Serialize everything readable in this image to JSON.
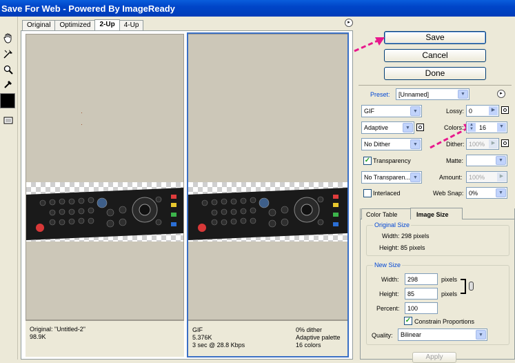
{
  "window": {
    "title": "Save For Web - Powered By ImageReady"
  },
  "tabs": [
    {
      "label": "Original",
      "active": false
    },
    {
      "label": "Optimized",
      "active": false
    },
    {
      "label": "2-Up",
      "active": true
    },
    {
      "label": "4-Up",
      "active": false
    }
  ],
  "tools": [
    "hand-icon",
    "slice-select-icon",
    "zoom-icon",
    "eyedropper-icon",
    "eyedropper-color-swatch",
    "toggle-slices-icon"
  ],
  "left_pane": {
    "line1": "Original: \"Untitled-2\"",
    "line2": "98.9K"
  },
  "right_pane": {
    "left_lines": [
      "GIF",
      "5.376K",
      "3 sec @ 28.8 Kbps"
    ],
    "right_lines": [
      "0% dither",
      "Adaptive palette",
      "16 colors"
    ]
  },
  "buttons": {
    "save": "Save",
    "cancel": "Cancel",
    "done": "Done"
  },
  "settings": {
    "preset_label": "Preset:",
    "preset_value": "[Unnamed]",
    "format": "GIF",
    "lossy_label": "Lossy:",
    "lossy_value": "0",
    "reduction": "Adaptive",
    "colors_label": "Colors:",
    "colors_value": "16",
    "dither_algo": "No Dither",
    "dither_label": "Dither:",
    "dither_value": "100%",
    "transparency_label": "Transparency",
    "transparency_checked": true,
    "matte_label": "Matte:",
    "matte_value": "",
    "transparency_dither": "No Transparen...",
    "amount_label": "Amount:",
    "amount_value": "100%",
    "interlaced_label": "Interlaced",
    "interlaced_checked": false,
    "websnap_label": "Web Snap:",
    "websnap_value": "0%"
  },
  "panel_tabs": [
    {
      "label": "Color Table",
      "active": false
    },
    {
      "label": "Image Size",
      "active": true
    }
  ],
  "image_size": {
    "original_size_label": "Original Size",
    "original_width": "Width: 298 pixels",
    "original_height": "Height: 85 pixels",
    "new_size_label": "New Size",
    "width_label": "Width:",
    "width_value": "298",
    "width_unit": "pixels",
    "height_label": "Height:",
    "height_value": "85",
    "height_unit": "pixels",
    "percent_label": "Percent:",
    "percent_value": "100",
    "constrain_label": "Constrain Proportions",
    "constrain_checked": true,
    "quality_label": "Quality:",
    "quality_value": "Bilinear",
    "apply_label": "Apply"
  },
  "colors": {
    "titlebar": "#0045c8",
    "selection_border": "#3a6fc4",
    "arrow_annotation": "#e8188c",
    "canvas_background": "#ccc7b8"
  }
}
